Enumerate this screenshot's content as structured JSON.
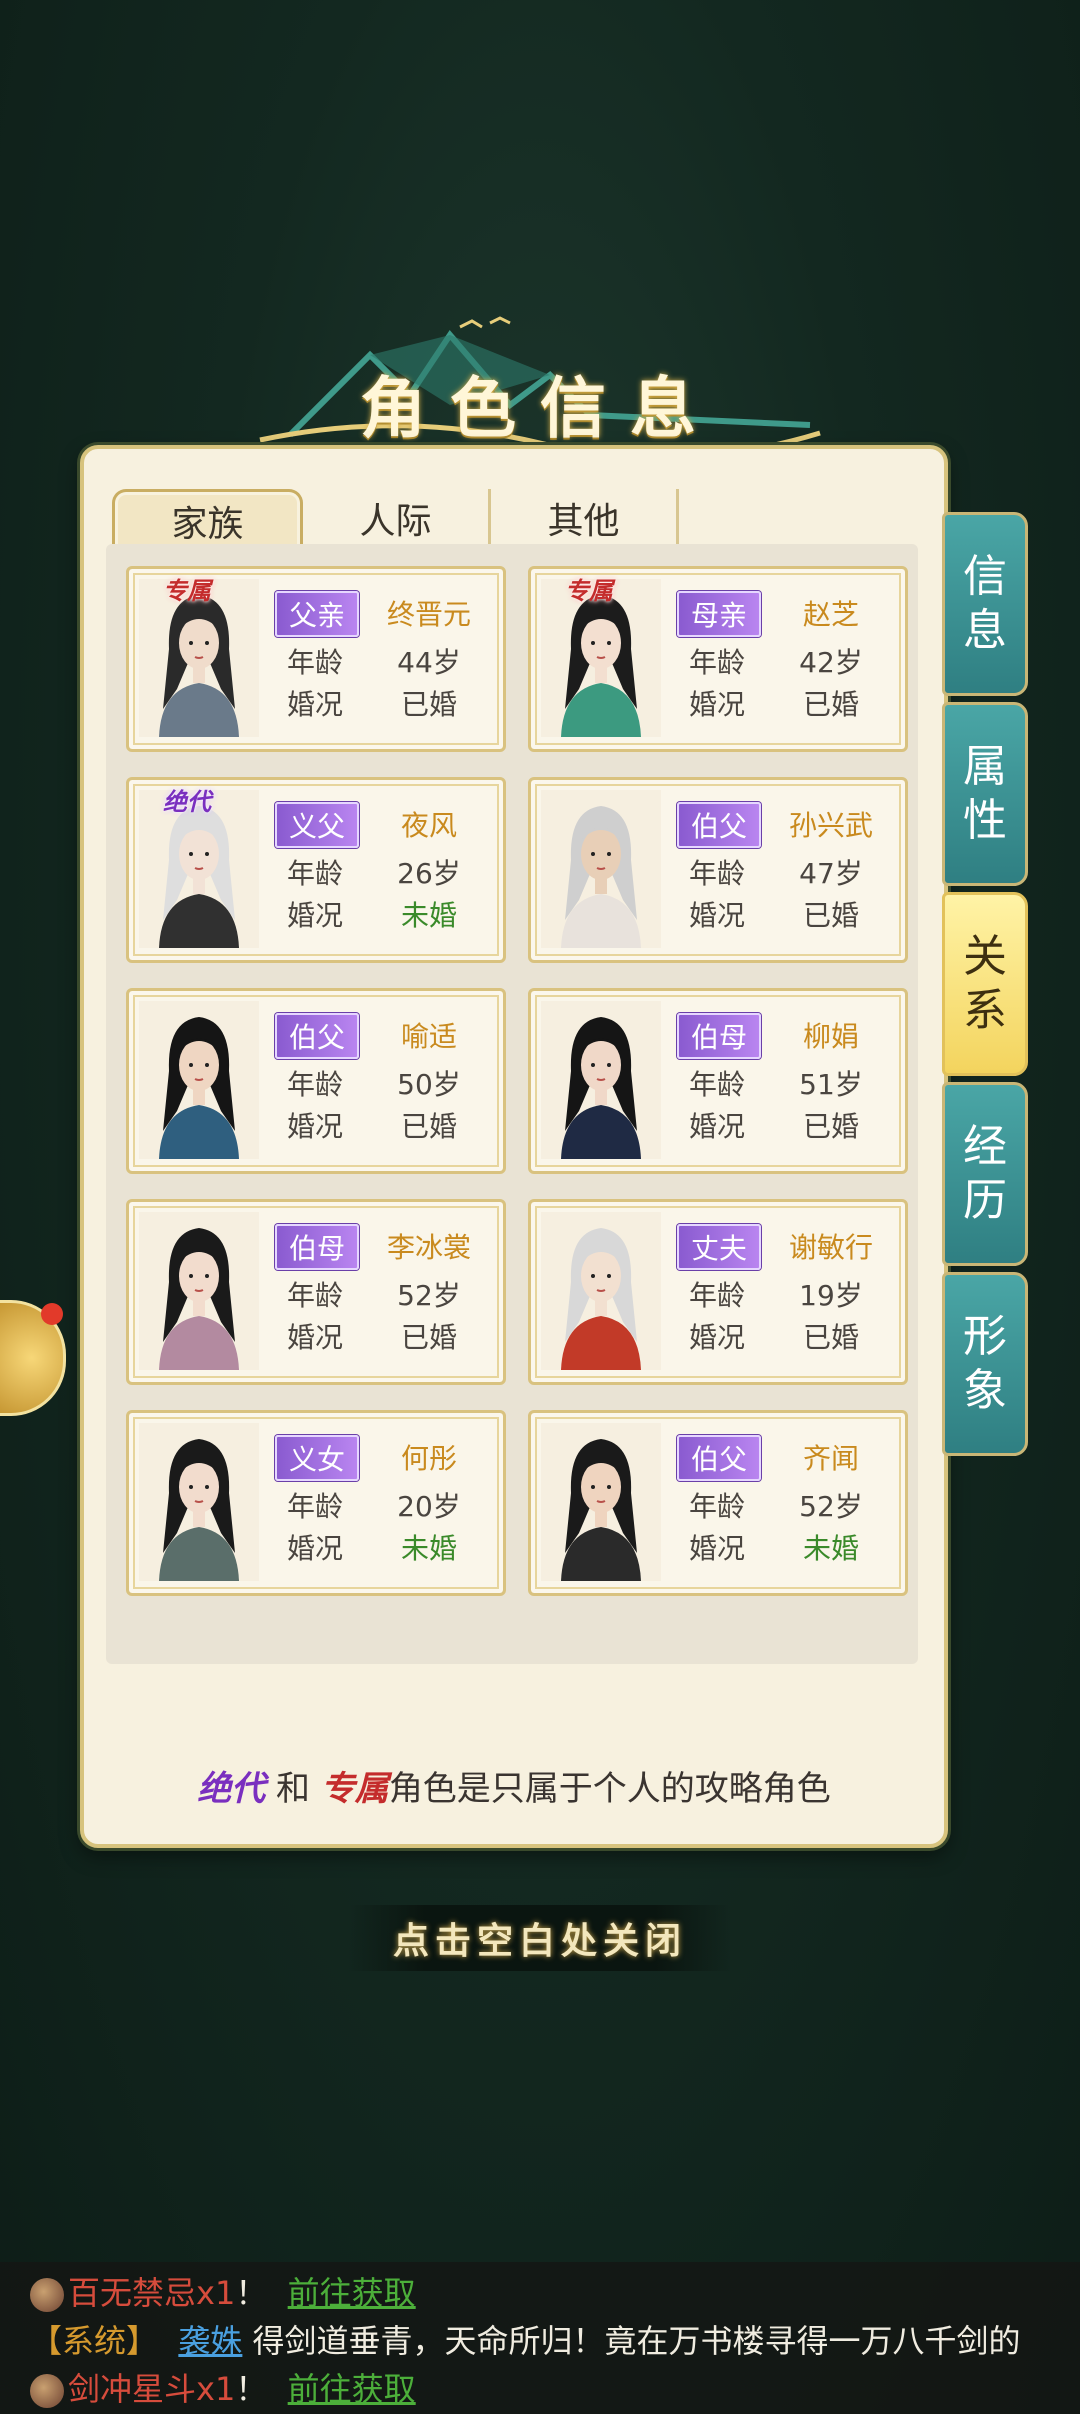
{
  "title": "角色信息",
  "tabs": [
    {
      "label": "家族",
      "active": true
    },
    {
      "label": "人际",
      "active": false
    },
    {
      "label": "其他",
      "active": false
    }
  ],
  "side_tabs": [
    {
      "label": "信息",
      "active": false
    },
    {
      "label": "属性",
      "active": false
    },
    {
      "label": "关系",
      "active": true
    },
    {
      "label": "经历",
      "active": false
    },
    {
      "label": "形象",
      "active": false
    }
  ],
  "row_labels": {
    "age": "年龄",
    "marriage": "婚况"
  },
  "cards": [
    {
      "tag": "专属",
      "tag_type": "exclusive",
      "relation": "父亲",
      "name": "终晋元",
      "age": "44岁",
      "marriage": "已婚",
      "single": false
    },
    {
      "tag": "专属",
      "tag_type": "exclusive",
      "relation": "母亲",
      "name": "赵芝",
      "age": "42岁",
      "marriage": "已婚",
      "single": false
    },
    {
      "tag": "绝代",
      "tag_type": "peerless",
      "relation": "义父",
      "name": "夜风",
      "age": "26岁",
      "marriage": "未婚",
      "single": true
    },
    {
      "tag": "",
      "tag_type": "",
      "relation": "伯父",
      "name": "孙兴武",
      "age": "47岁",
      "marriage": "已婚",
      "single": false
    },
    {
      "tag": "",
      "tag_type": "",
      "relation": "伯父",
      "name": "喻适",
      "age": "50岁",
      "marriage": "已婚",
      "single": false
    },
    {
      "tag": "",
      "tag_type": "",
      "relation": "伯母",
      "name": "柳娟",
      "age": "51岁",
      "marriage": "已婚",
      "single": false
    },
    {
      "tag": "",
      "tag_type": "",
      "relation": "伯母",
      "name": "李冰裳",
      "age": "52岁",
      "marriage": "已婚",
      "single": false
    },
    {
      "tag": "",
      "tag_type": "",
      "relation": "丈夫",
      "name": "谢敏行",
      "age": "19岁",
      "marriage": "已婚",
      "single": false
    },
    {
      "tag": "",
      "tag_type": "",
      "relation": "义女",
      "name": "何彤",
      "age": "20岁",
      "marriage": "未婚",
      "single": true
    },
    {
      "tag": "",
      "tag_type": "",
      "relation": "伯父",
      "name": "齐闻",
      "age": "52岁",
      "marriage": "未婚",
      "single": true
    }
  ],
  "note": {
    "peerless": "绝代",
    "and": "和",
    "exclusive": "专属",
    "rest": "角色是只属于个人的攻略角色"
  },
  "close_hint": "点击空白处关闭",
  "chat": {
    "line1": {
      "item": "百无禁忌x1",
      "sep": "！",
      "link": "前往获取"
    },
    "line2": {
      "sys": "【系统】",
      "user": "袭姝",
      "text": "得剑道垂青，天命所归！竟在万书楼寻得一万八千剑的"
    },
    "line3": {
      "item": "剑冲星斗x1",
      "sep": "！",
      "link": "前往获取"
    }
  },
  "colors": {
    "accent_gold": "#c98a1e",
    "single_green": "#3a8a2a",
    "badge_purple": "#9a6ae0",
    "side_tab_teal": "#3a9595"
  }
}
